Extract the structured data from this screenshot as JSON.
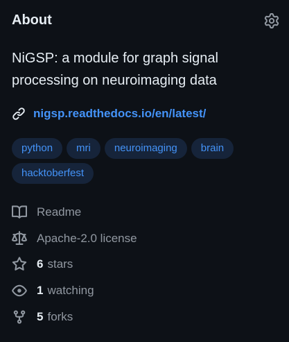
{
  "about": {
    "title": "About",
    "description": "NiGSP: a module for graph signal processing on neuroimaging data",
    "link": "nigsp.readthedocs.io/en/latest/",
    "topics": [
      "python",
      "mri",
      "neuroimaging",
      "brain",
      "hacktoberfest"
    ],
    "readme_label": "Readme",
    "license_label": "Apache-2.0 license",
    "stars": {
      "count": "6",
      "label": "stars"
    },
    "watching": {
      "count": "1",
      "label": "watching"
    },
    "forks": {
      "count": "5",
      "label": "forks"
    }
  },
  "icons": {
    "settings": "gear-icon",
    "link": "link-icon",
    "readme": "book-icon",
    "license": "law-scale-icon",
    "stars": "star-icon",
    "watching": "eye-icon",
    "forks": "fork-icon"
  },
  "colors": {
    "background": "#0d1117",
    "text": "#e6edf3",
    "muted": "#9198a1",
    "link": "#4493f8",
    "topic_bg": "#16243a"
  }
}
